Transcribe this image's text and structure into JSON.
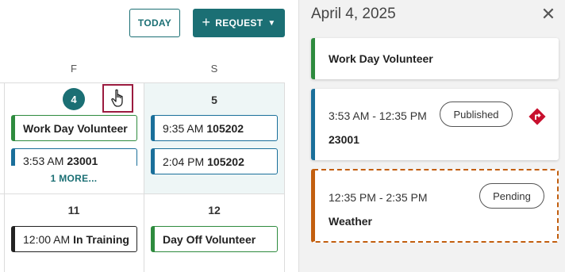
{
  "toolbar": {
    "today_label": "TODAY",
    "request_label": "REQUEST",
    "request_icon": "plus-icon",
    "request_caret_icon": "caret-down-icon"
  },
  "calendar": {
    "day_headers": [
      "F",
      "S"
    ],
    "week1": {
      "friday": {
        "date": "4",
        "events": [
          {
            "label": "Work Day Volunteer"
          },
          {
            "time": "3:53 AM",
            "title": "23001"
          }
        ],
        "more": "1 MORE..."
      },
      "saturday": {
        "date": "5",
        "events": [
          {
            "time": "9:35 AM",
            "title": "105202"
          },
          {
            "time": "2:04 PM",
            "title": "105202"
          }
        ]
      }
    },
    "week2": {
      "friday": {
        "date": "11",
        "events": [
          {
            "time": "12:00 AM",
            "title": "In Training"
          }
        ]
      },
      "saturday": {
        "date": "12",
        "events": [
          {
            "label": "Day Off Volunteer"
          }
        ]
      }
    }
  },
  "panel": {
    "date": "April 4, 2025",
    "close_icon": "close-icon",
    "cards": [
      {
        "title": "Work Day Volunteer",
        "accent": "#2e8b3e"
      },
      {
        "time": "3:53 AM - 12:35 PM",
        "status": "Published",
        "title": "23001",
        "accent": "#1a6f9a",
        "icon": "diamond-turn-icon"
      },
      {
        "time": "12:35 PM - 2:35 PM",
        "status": "Pending",
        "title": "Weather",
        "accent": "#c25e0e"
      }
    ]
  },
  "colors": {
    "teal": "#1b6f74",
    "green": "#2e8b3e",
    "blue": "#1a6f9a",
    "orange": "#c25e0e",
    "pointer_border": "#9b1b3f",
    "diamond_red": "#c8102e"
  }
}
